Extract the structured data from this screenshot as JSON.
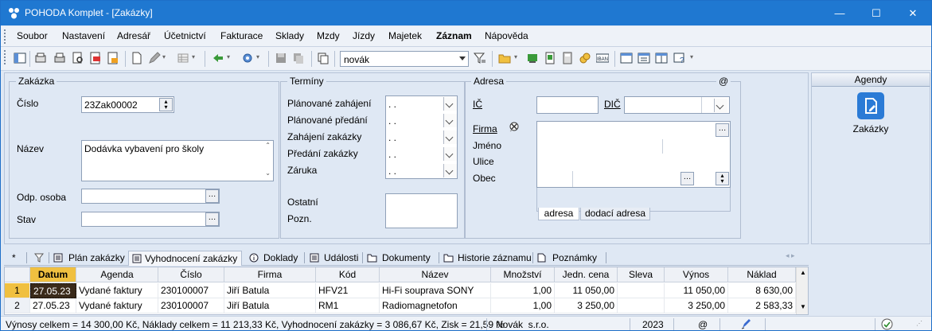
{
  "window": {
    "title": "POHODA Komplet - [Zakázky]",
    "minimize": "—",
    "maximize": "☐",
    "close": "✕"
  },
  "menu": [
    "Soubor",
    "Nastavení",
    "Adresář",
    "Účetnictví",
    "Fakturace",
    "Sklady",
    "Mzdy",
    "Jízdy",
    "Majetek",
    "Záznam",
    "Nápověda"
  ],
  "toolbar": {
    "user_combo": "novák"
  },
  "form": {
    "zakazka": {
      "group": "Zakázka",
      "cislo_label": "Číslo",
      "cislo": "23Zak00002",
      "nazev_label": "Název",
      "nazev": "Dodávka vybavení pro školy",
      "odp_label": "Odp. osoba",
      "odp": "",
      "stav_label": "Stav",
      "stav": ""
    },
    "terminy": {
      "group": "Termíny",
      "rows": [
        {
          "label": "Plánované zahájení",
          "value": ". ."
        },
        {
          "label": "Plánované předání",
          "value": ". ."
        },
        {
          "label": "Zahájení zakázky",
          "value": ". ."
        },
        {
          "label": "Předání zakázky",
          "value": ". ."
        },
        {
          "label": "Záruka",
          "value": ". ."
        }
      ],
      "ostatni_label": "Ostatní",
      "pozn_label": "Pozn."
    },
    "adresa": {
      "group": "Adresa",
      "at": "@",
      "ic_label": "IČ",
      "dic_label": "DIČ",
      "firma_label": "Firma",
      "jmeno_label": "Jméno",
      "ulice_label": "Ulice",
      "obec_label": "Obec",
      "tab_adresa": "adresa",
      "tab_dodaci": "dodací adresa"
    }
  },
  "agendy": {
    "title": "Agendy",
    "item": "Zakázky",
    "accent": "#2b7bd6"
  },
  "tabs": [
    "*",
    "",
    "Plán zakázky",
    "Vyhodnocení zakázky",
    "Doklady",
    "Události",
    "Dokumenty",
    "Historie záznamu",
    "Poznámky"
  ],
  "grid": {
    "columns": [
      "Datum",
      "Agenda",
      "Číslo",
      "Firma",
      "Kód",
      "Název",
      "Množství",
      "Jedn. cena",
      "Sleva",
      "Výnos",
      "Náklad"
    ],
    "rows": [
      {
        "n": "1",
        "datum": "27.05.23",
        "agenda": "Vydané faktury",
        "cislo": "230100007",
        "firma": "Jiří Batula",
        "kod": "HFV21",
        "nazev": "Hi-Fi souprava SONY",
        "mnozstvi": "1,00",
        "cena": "11 050,00",
        "sleva": "",
        "vynos": "11 050,00",
        "naklad": "8 630,00"
      },
      {
        "n": "2",
        "datum": "27.05.23",
        "agenda": "Vydané faktury",
        "cislo": "230100007",
        "firma": "Jiří Batula",
        "kod": "RM1",
        "nazev": "Radiomagnetofon",
        "mnozstvi": "1,00",
        "cena": "3 250,00",
        "sleva": "",
        "vynos": "3 250,00",
        "naklad": "2 583,33"
      }
    ]
  },
  "status": {
    "summary": "Výnosy celkem = 14 300,00 Kč, Náklady celkem = 11 213,33 Kč, Vyhodnocení zakázky = 3 086,67 Kč, Zisk = 21,59 %",
    "company": "Novák  s.r.o.",
    "year": "2023",
    "at": "@"
  }
}
